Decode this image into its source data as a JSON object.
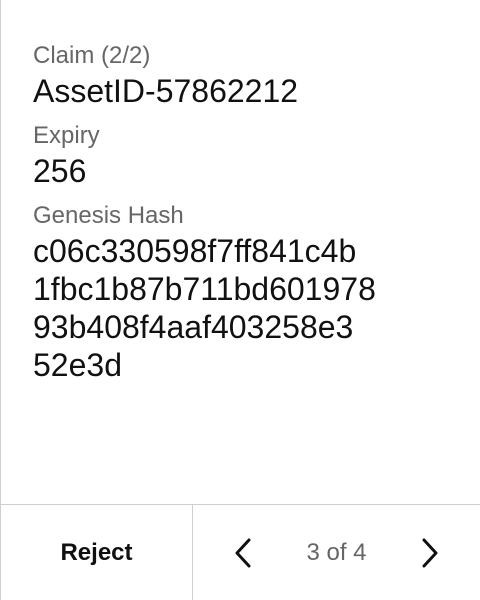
{
  "fields": [
    {
      "label": "Claim (2/2)",
      "value": "AssetID-57862212"
    },
    {
      "label": "Expiry",
      "value": "256"
    },
    {
      "label": "Genesis Hash",
      "value_lines": [
        "c06c330598f7ff841c4b",
        "1fbc1b87b711bd601978",
        "93b408f4aaf403258e3",
        "52e3d"
      ]
    }
  ],
  "footer": {
    "reject_label": "Reject",
    "pager_text": "3 of 4",
    "prev_icon": "chevron-left-icon",
    "next_icon": "chevron-right-icon"
  },
  "colors": {
    "text": "#111111",
    "muted": "#666666",
    "border": "#cfcfcf",
    "background": "#ffffff"
  }
}
